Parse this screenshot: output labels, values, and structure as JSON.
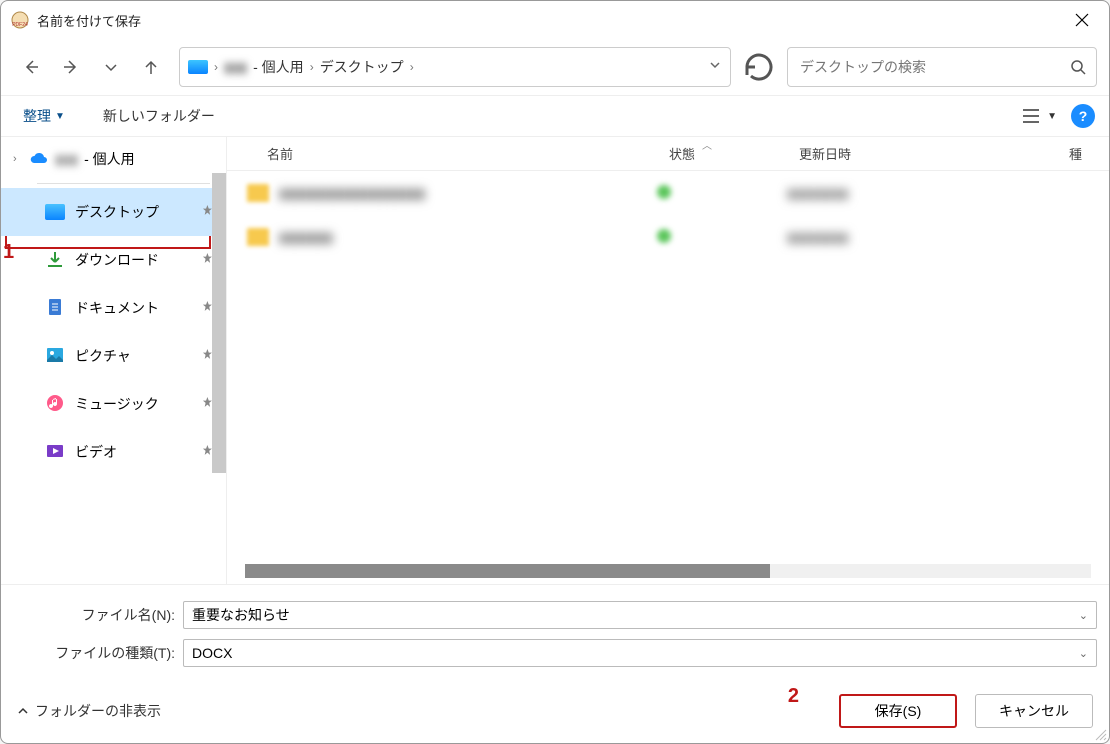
{
  "window": {
    "title": "名前を付けて保存"
  },
  "breadcrumb": {
    "obscured": "▮▮▮",
    "personal": "- 個人用",
    "desktop": "デスクトップ"
  },
  "search": {
    "placeholder": "デスクトップの検索"
  },
  "toolbar": {
    "organize": "整理",
    "newfolder": "新しいフォルダー"
  },
  "tree": {
    "top_obscured": "▮▮▮",
    "top_personal": "- 個人用",
    "items": [
      {
        "label": "デスクトップ"
      },
      {
        "label": "ダウンロード"
      },
      {
        "label": "ドキュメント"
      },
      {
        "label": "ピクチャ"
      },
      {
        "label": "ミュージック"
      },
      {
        "label": "ビデオ"
      }
    ]
  },
  "columns": {
    "name": "名前",
    "state": "状態",
    "date": "更新日時",
    "kind": "種"
  },
  "files": [
    {
      "name": "▮▮▮▮▮▮▮▮▮▮▮▮▮▮▮▮▮▮▮",
      "date": "▮▮▮▮▮▮▮▮"
    },
    {
      "name": "▮▮▮▮▮▮▮",
      "date": "▮▮▮▮▮▮▮▮"
    }
  ],
  "form": {
    "filename_label": "ファイル名(N):",
    "filename_value": "重要なお知らせ",
    "filetype_label": "ファイルの種類(T):",
    "filetype_value": "DOCX"
  },
  "footer": {
    "hide_folders": "フォルダーの非表示",
    "save": "保存(S)",
    "cancel": "キャンセル"
  },
  "annotations": {
    "one": "1",
    "two": "2"
  }
}
